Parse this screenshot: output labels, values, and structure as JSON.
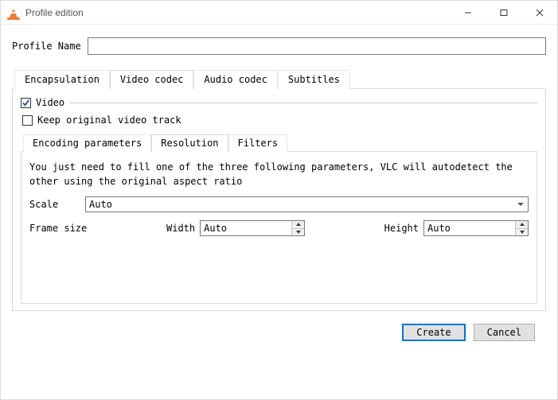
{
  "window": {
    "title": "Profile edition"
  },
  "profile": {
    "label": "Profile Name",
    "value": ""
  },
  "tabs": {
    "encapsulation": "Encapsulation",
    "video_codec": "Video codec",
    "audio_codec": "Audio codec",
    "subtitles": "Subtitles"
  },
  "video_codec": {
    "video_checkbox": "Video",
    "keep_original": "Keep original video track",
    "inner_tabs": {
      "encoding": "Encoding parameters",
      "resolution": "Resolution",
      "filters": "Filters"
    },
    "resolution": {
      "help": "You just need to fill one of the three following parameters, VLC will autodetect the other using the original aspect ratio",
      "scale_label": "Scale",
      "scale_value": "Auto",
      "frame_size_label": "Frame size",
      "width_label": "Width",
      "width_value": "Auto",
      "height_label": "Height",
      "height_value": "Auto"
    }
  },
  "buttons": {
    "create": "Create",
    "cancel": "Cancel"
  }
}
